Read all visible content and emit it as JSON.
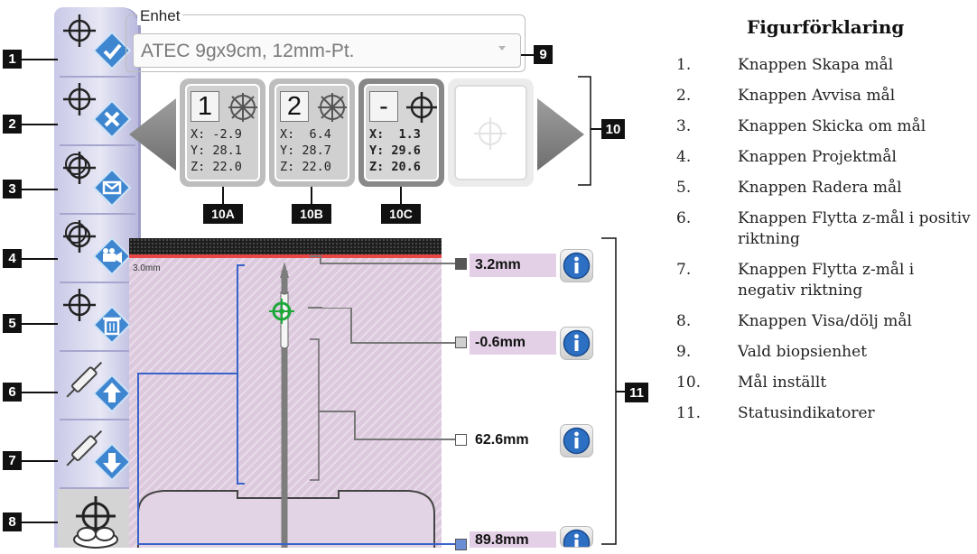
{
  "toolbar": {
    "buttons": [
      {
        "num": "1",
        "icon": "create-target-icon"
      },
      {
        "num": "2",
        "icon": "reject-target-icon"
      },
      {
        "num": "3",
        "icon": "resend-targets-icon"
      },
      {
        "num": "4",
        "icon": "project-targets-icon"
      },
      {
        "num": "5",
        "icon": "delete-target-icon"
      },
      {
        "num": "6",
        "icon": "jog-positive-icon"
      },
      {
        "num": "7",
        "icon": "jog-negative-icon"
      },
      {
        "num": "8",
        "icon": "show-hide-targets-icon"
      }
    ]
  },
  "device": {
    "legend": "Enhet",
    "selected": "ATEC 9gx9cm, 12mm-Pt.",
    "callout": "9"
  },
  "targets": {
    "callout": "10",
    "cards": [
      {
        "index": "1",
        "x": "X: -2.9",
        "y": "Y: 28.1",
        "z": "Z: 22.0",
        "callout": "10A",
        "state": "rejected"
      },
      {
        "index": "2",
        "x": "X:  6.4",
        "y": "Y: 28.7",
        "z": "Z: 22.0",
        "callout": "10B",
        "state": "rejected"
      },
      {
        "index": "-",
        "x": "X:  1.3",
        "y": "Y: 29.6",
        "z": "Z: 20.6",
        "callout": "10C",
        "state": "active"
      }
    ]
  },
  "status": {
    "callout": "11",
    "scale": "3.0mm",
    "indicators": [
      {
        "value": "3.2mm",
        "color": "#555555"
      },
      {
        "value": "-0.6mm",
        "color": "#cfcfcf"
      },
      {
        "value": "62.6mm",
        "color": "#ffffff"
      },
      {
        "value": "89.8mm",
        "color": "#6b8fd4"
      }
    ]
  },
  "legend": {
    "title": "Figurförklaring",
    "items": [
      {
        "n": "1.",
        "text": "Knappen Skapa mål"
      },
      {
        "n": "2.",
        "text": "Knappen Avvisa mål"
      },
      {
        "n": "3.",
        "text": "Knappen Skicka om mål"
      },
      {
        "n": "4.",
        "text": "Knappen Projektmål"
      },
      {
        "n": "5.",
        "text": "Knappen Radera mål"
      },
      {
        "n": "6.",
        "text": "Knappen Flytta z-mål i positiv riktning"
      },
      {
        "n": "7.",
        "text": "Knappen Flytta z-mål i negativ riktning"
      },
      {
        "n": "8.",
        "text": "Knappen Visa/dölj mål"
      },
      {
        "n": "9.",
        "text": "Vald biopsienhet"
      },
      {
        "n": "10.",
        "text": "Mål inställt"
      },
      {
        "n": "11.",
        "text": "Statusindikatorer"
      }
    ]
  }
}
